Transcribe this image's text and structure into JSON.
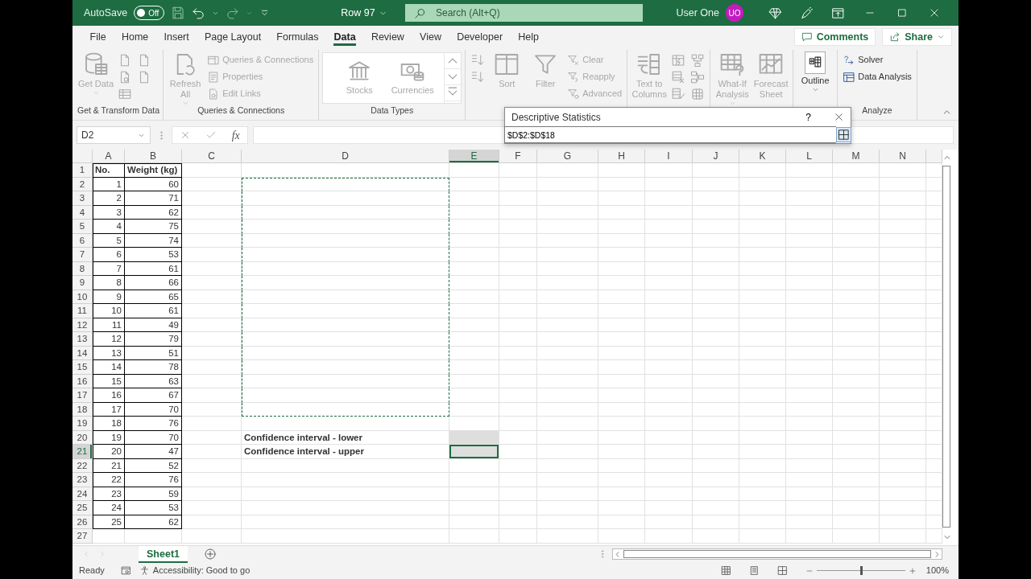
{
  "title_bar": {
    "autosave_label": "AutoSave",
    "autosave_toggle": {
      "label": "Off",
      "on": false
    },
    "document_title": "Row 97",
    "search": {
      "placeholder": "Search (Alt+Q)"
    },
    "user_name": "User One",
    "avatar_initials": "UO"
  },
  "menu_tabs": [
    {
      "label": "File",
      "selected": false
    },
    {
      "label": "Home",
      "selected": false
    },
    {
      "label": "Insert",
      "selected": false
    },
    {
      "label": "Page Layout",
      "selected": false
    },
    {
      "label": "Formulas",
      "selected": false
    },
    {
      "label": "Data",
      "selected": true
    },
    {
      "label": "Review",
      "selected": false
    },
    {
      "label": "View",
      "selected": false
    },
    {
      "label": "Developer",
      "selected": false
    },
    {
      "label": "Help",
      "selected": false
    }
  ],
  "comments_button": "Comments",
  "share_button": "Share",
  "ribbon": {
    "groups": [
      {
        "label": "Get & Transform Data",
        "kind": "buttons",
        "items": [
          {
            "kind": "large",
            "text": "Get Data",
            "caret": true,
            "disabled": true
          },
          {
            "kind": "icon",
            "disabled": true
          },
          {
            "kind": "icon",
            "disabled": true
          },
          {
            "kind": "icon",
            "disabled": true
          },
          {
            "kind": "icon",
            "disabled": true
          },
          {
            "kind": "icon",
            "disabled": true
          }
        ]
      },
      {
        "label": "Queries & Connections",
        "kind": "buttons",
        "items": [
          {
            "kind": "large",
            "text": "Refresh All",
            "caret": true,
            "disabled": true
          },
          {
            "kind": "small",
            "text": "Queries & Connections",
            "disabled": true
          },
          {
            "kind": "small",
            "text": "Properties",
            "disabled": true
          },
          {
            "kind": "small",
            "text": "Edit Links",
            "disabled": true
          }
        ]
      },
      {
        "label": "Data Types",
        "kind": "gallery",
        "items": [
          {
            "kind": "large",
            "text": "Stocks",
            "disabled": true
          },
          {
            "kind": "large",
            "text": "Currencies",
            "disabled": true
          }
        ]
      },
      {
        "kind": "buttons",
        "items": [
          {
            "kind": "icon",
            "disabled": true
          },
          {
            "kind": "icon",
            "disabled": true
          },
          {
            "kind": "large",
            "text": "Sort",
            "disabled": true
          },
          {
            "kind": "large",
            "text": "Filter",
            "disabled": true
          },
          {
            "kind": "small",
            "text": "Clear",
            "disabled": true
          },
          {
            "kind": "small",
            "text": "Reapply",
            "disabled": true
          },
          {
            "kind": "small",
            "text": "Advanced",
            "disabled": true
          }
        ]
      },
      {
        "kind": "buttons",
        "items": [
          {
            "kind": "large",
            "text": "Text to Columns",
            "disabled": true
          },
          {
            "kind": "icon",
            "disabled": true
          },
          {
            "kind": "icon",
            "disabled": true
          },
          {
            "kind": "icon",
            "disabled": true
          },
          {
            "kind": "icon",
            "disabled": true
          },
          {
            "kind": "icon",
            "disabled": true
          },
          {
            "kind": "icon",
            "disabled": true
          }
        ]
      },
      {
        "kind": "buttons",
        "items": [
          {
            "kind": "large",
            "text": "What-If Analysis",
            "caret": true,
            "disabled": true
          },
          {
            "kind": "large",
            "text": "Forecast Sheet",
            "disabled": true
          }
        ]
      },
      {
        "kind": "buttons",
        "items": [
          {
            "kind": "large",
            "text": "Outline",
            "caret": true,
            "disabled": false
          }
        ]
      },
      {
        "label": "Analyze",
        "kind": "buttons",
        "items": [
          {
            "kind": "small",
            "text": "Solver",
            "disabled": false
          },
          {
            "kind": "small",
            "text": "Data Analysis",
            "disabled": false
          }
        ]
      }
    ]
  },
  "formula_bar": {
    "name_box": "D2",
    "fx": "fx"
  },
  "dialog": {
    "title": "Descriptive Statistics",
    "help": "?",
    "range": "$D$2:$D$18"
  },
  "sheet": {
    "columns": [
      {
        "label": "A",
        "selected": false
      },
      {
        "label": "B",
        "selected": false
      },
      {
        "label": "C",
        "selected": false
      },
      {
        "label": "D",
        "selected": false
      },
      {
        "label": "E",
        "selected": true
      },
      {
        "label": "F",
        "selected": false
      },
      {
        "label": "G",
        "selected": false
      },
      {
        "label": "H",
        "selected": false
      },
      {
        "label": "I",
        "selected": false
      },
      {
        "label": "J",
        "selected": false
      },
      {
        "label": "K",
        "selected": false
      },
      {
        "label": "L",
        "selected": false
      },
      {
        "label": "M",
        "selected": false
      },
      {
        "label": "N",
        "selected": false
      }
    ],
    "rows": [
      {
        "number": "1",
        "selected": false,
        "cells": {
          "A": {
            "kind": "header",
            "text": "No.",
            "selected": false
          },
          "B": {
            "kind": "header",
            "text": "Weight (kg)",
            "selected": false
          }
        }
      },
      {
        "number": "2",
        "selected": false,
        "cells": {
          "A": {
            "kind": "number",
            "text": "1",
            "selected": false
          },
          "B": {
            "kind": "number",
            "text": "60",
            "selected": false
          },
          "D": {
            "marquee": true,
            "selected": false
          }
        }
      },
      {
        "number": "3",
        "selected": false,
        "cells": {
          "A": {
            "kind": "number",
            "text": "2",
            "selected": false
          },
          "B": {
            "kind": "number",
            "text": "71",
            "selected": false
          },
          "D": {
            "marquee": true,
            "selected": false
          }
        }
      },
      {
        "number": "4",
        "selected": false,
        "cells": {
          "A": {
            "kind": "number",
            "text": "3",
            "selected": false
          },
          "B": {
            "kind": "number",
            "text": "62",
            "selected": false
          },
          "D": {
            "marquee": true,
            "selected": false
          }
        }
      },
      {
        "number": "5",
        "selected": false,
        "cells": {
          "A": {
            "kind": "number",
            "text": "4",
            "selected": false
          },
          "B": {
            "kind": "number",
            "text": "75",
            "selected": false
          },
          "D": {
            "marquee": true,
            "selected": false
          }
        }
      },
      {
        "number": "6",
        "selected": false,
        "cells": {
          "A": {
            "kind": "number",
            "text": "5",
            "selected": false
          },
          "B": {
            "kind": "number",
            "text": "74",
            "selected": false
          },
          "D": {
            "marquee": true,
            "selected": false
          }
        }
      },
      {
        "number": "7",
        "selected": false,
        "cells": {
          "A": {
            "kind": "number",
            "text": "6",
            "selected": false
          },
          "B": {
            "kind": "number",
            "text": "53",
            "selected": false
          },
          "D": {
            "marquee": true,
            "selected": false
          }
        }
      },
      {
        "number": "8",
        "selected": false,
        "cells": {
          "A": {
            "kind": "number",
            "text": "7",
            "selected": false
          },
          "B": {
            "kind": "number",
            "text": "61",
            "selected": false
          },
          "D": {
            "marquee": true,
            "selected": false
          }
        }
      },
      {
        "number": "9",
        "selected": false,
        "cells": {
          "A": {
            "kind": "number",
            "text": "8",
            "selected": false
          },
          "B": {
            "kind": "number",
            "text": "66",
            "selected": false
          },
          "D": {
            "marquee": true,
            "selected": false
          }
        }
      },
      {
        "number": "10",
        "selected": false,
        "cells": {
          "A": {
            "kind": "number",
            "text": "9",
            "selected": false
          },
          "B": {
            "kind": "number",
            "text": "65",
            "selected": false
          },
          "D": {
            "marquee": true,
            "selected": false
          }
        }
      },
      {
        "number": "11",
        "selected": false,
        "cells": {
          "A": {
            "kind": "number",
            "text": "10",
            "selected": false
          },
          "B": {
            "kind": "number",
            "text": "61",
            "selected": false
          },
          "D": {
            "marquee": true,
            "selected": false
          }
        }
      },
      {
        "number": "12",
        "selected": false,
        "cells": {
          "A": {
            "kind": "number",
            "text": "11",
            "selected": false
          },
          "B": {
            "kind": "number",
            "text": "49",
            "selected": false
          },
          "D": {
            "marquee": true,
            "selected": false
          }
        }
      },
      {
        "number": "13",
        "selected": false,
        "cells": {
          "A": {
            "kind": "number",
            "text": "12",
            "selected": false
          },
          "B": {
            "kind": "number",
            "text": "79",
            "selected": false
          },
          "D": {
            "marquee": true,
            "selected": false
          }
        }
      },
      {
        "number": "14",
        "selected": false,
        "cells": {
          "A": {
            "kind": "number",
            "text": "13",
            "selected": false
          },
          "B": {
            "kind": "number",
            "text": "51",
            "selected": false
          },
          "D": {
            "marquee": true,
            "selected": false
          }
        }
      },
      {
        "number": "15",
        "selected": false,
        "cells": {
          "A": {
            "kind": "number",
            "text": "14",
            "selected": false
          },
          "B": {
            "kind": "number",
            "text": "78",
            "selected": false
          },
          "D": {
            "marquee": true,
            "selected": false
          }
        }
      },
      {
        "number": "16",
        "selected": false,
        "cells": {
          "A": {
            "kind": "number",
            "text": "15",
            "selected": false
          },
          "B": {
            "kind": "number",
            "text": "63",
            "selected": false
          },
          "D": {
            "marquee": true,
            "selected": false
          }
        }
      },
      {
        "number": "17",
        "selected": false,
        "cells": {
          "A": {
            "kind": "number",
            "text": "16",
            "selected": false
          },
          "B": {
            "kind": "number",
            "text": "67",
            "selected": false
          },
          "D": {
            "marquee": true,
            "selected": false
          }
        }
      },
      {
        "number": "18",
        "selected": false,
        "cells": {
          "A": {
            "kind": "number",
            "text": "17",
            "selected": false
          },
          "B": {
            "kind": "number",
            "text": "70",
            "selected": false
          },
          "D": {
            "marquee": true,
            "selected": false
          }
        }
      },
      {
        "number": "19",
        "selected": false,
        "cells": {
          "A": {
            "kind": "number",
            "text": "18",
            "selected": false
          },
          "B": {
            "kind": "number",
            "text": "76",
            "selected": false
          }
        }
      },
      {
        "number": "20",
        "selected": false,
        "cells": {
          "A": {
            "kind": "number",
            "text": "19",
            "selected": false
          },
          "B": {
            "kind": "number",
            "text": "70",
            "selected": false
          },
          "D": {
            "kind": "label",
            "text": "Confidence interval - lower",
            "selected": false
          },
          "E": {
            "selected": true,
            "active": false
          }
        }
      },
      {
        "number": "21",
        "selected": true,
        "cells": {
          "A": {
            "kind": "number",
            "text": "20",
            "selected": false
          },
          "B": {
            "kind": "number",
            "text": "47",
            "selected": false
          },
          "D": {
            "kind": "label",
            "text": "Confidence interval - upper",
            "selected": false
          },
          "E": {
            "selected": true,
            "active": true
          }
        }
      },
      {
        "number": "22",
        "selected": false,
        "cells": {
          "A": {
            "kind": "number",
            "text": "21",
            "selected": false
          },
          "B": {
            "kind": "number",
            "text": "52",
            "selected": false
          }
        }
      },
      {
        "number": "23",
        "selected": false,
        "cells": {
          "A": {
            "kind": "number",
            "text": "22",
            "selected": false
          },
          "B": {
            "kind": "number",
            "text": "76",
            "selected": false
          }
        }
      },
      {
        "number": "24",
        "selected": false,
        "cells": {
          "A": {
            "kind": "number",
            "text": "23",
            "selected": false
          },
          "B": {
            "kind": "number",
            "text": "59",
            "selected": false
          }
        }
      },
      {
        "number": "25",
        "selected": false,
        "cells": {
          "A": {
            "kind": "number",
            "text": "24",
            "selected": false
          },
          "B": {
            "kind": "number",
            "text": "53",
            "selected": false
          }
        }
      },
      {
        "number": "26",
        "selected": false,
        "cells": {
          "A": {
            "kind": "number",
            "text": "25",
            "selected": false
          },
          "B": {
            "kind": "number",
            "text": "62",
            "selected": false
          }
        }
      },
      {
        "number": "27",
        "selected": false
      }
    ]
  },
  "sheet_tabs": [
    {
      "label": "Sheet1",
      "selected": true
    }
  ],
  "status_bar": {
    "status": "Ready",
    "accessibility": "Accessibility: Good to go",
    "zoom": {
      "level": 0.5,
      "reading": "100%"
    }
  }
}
